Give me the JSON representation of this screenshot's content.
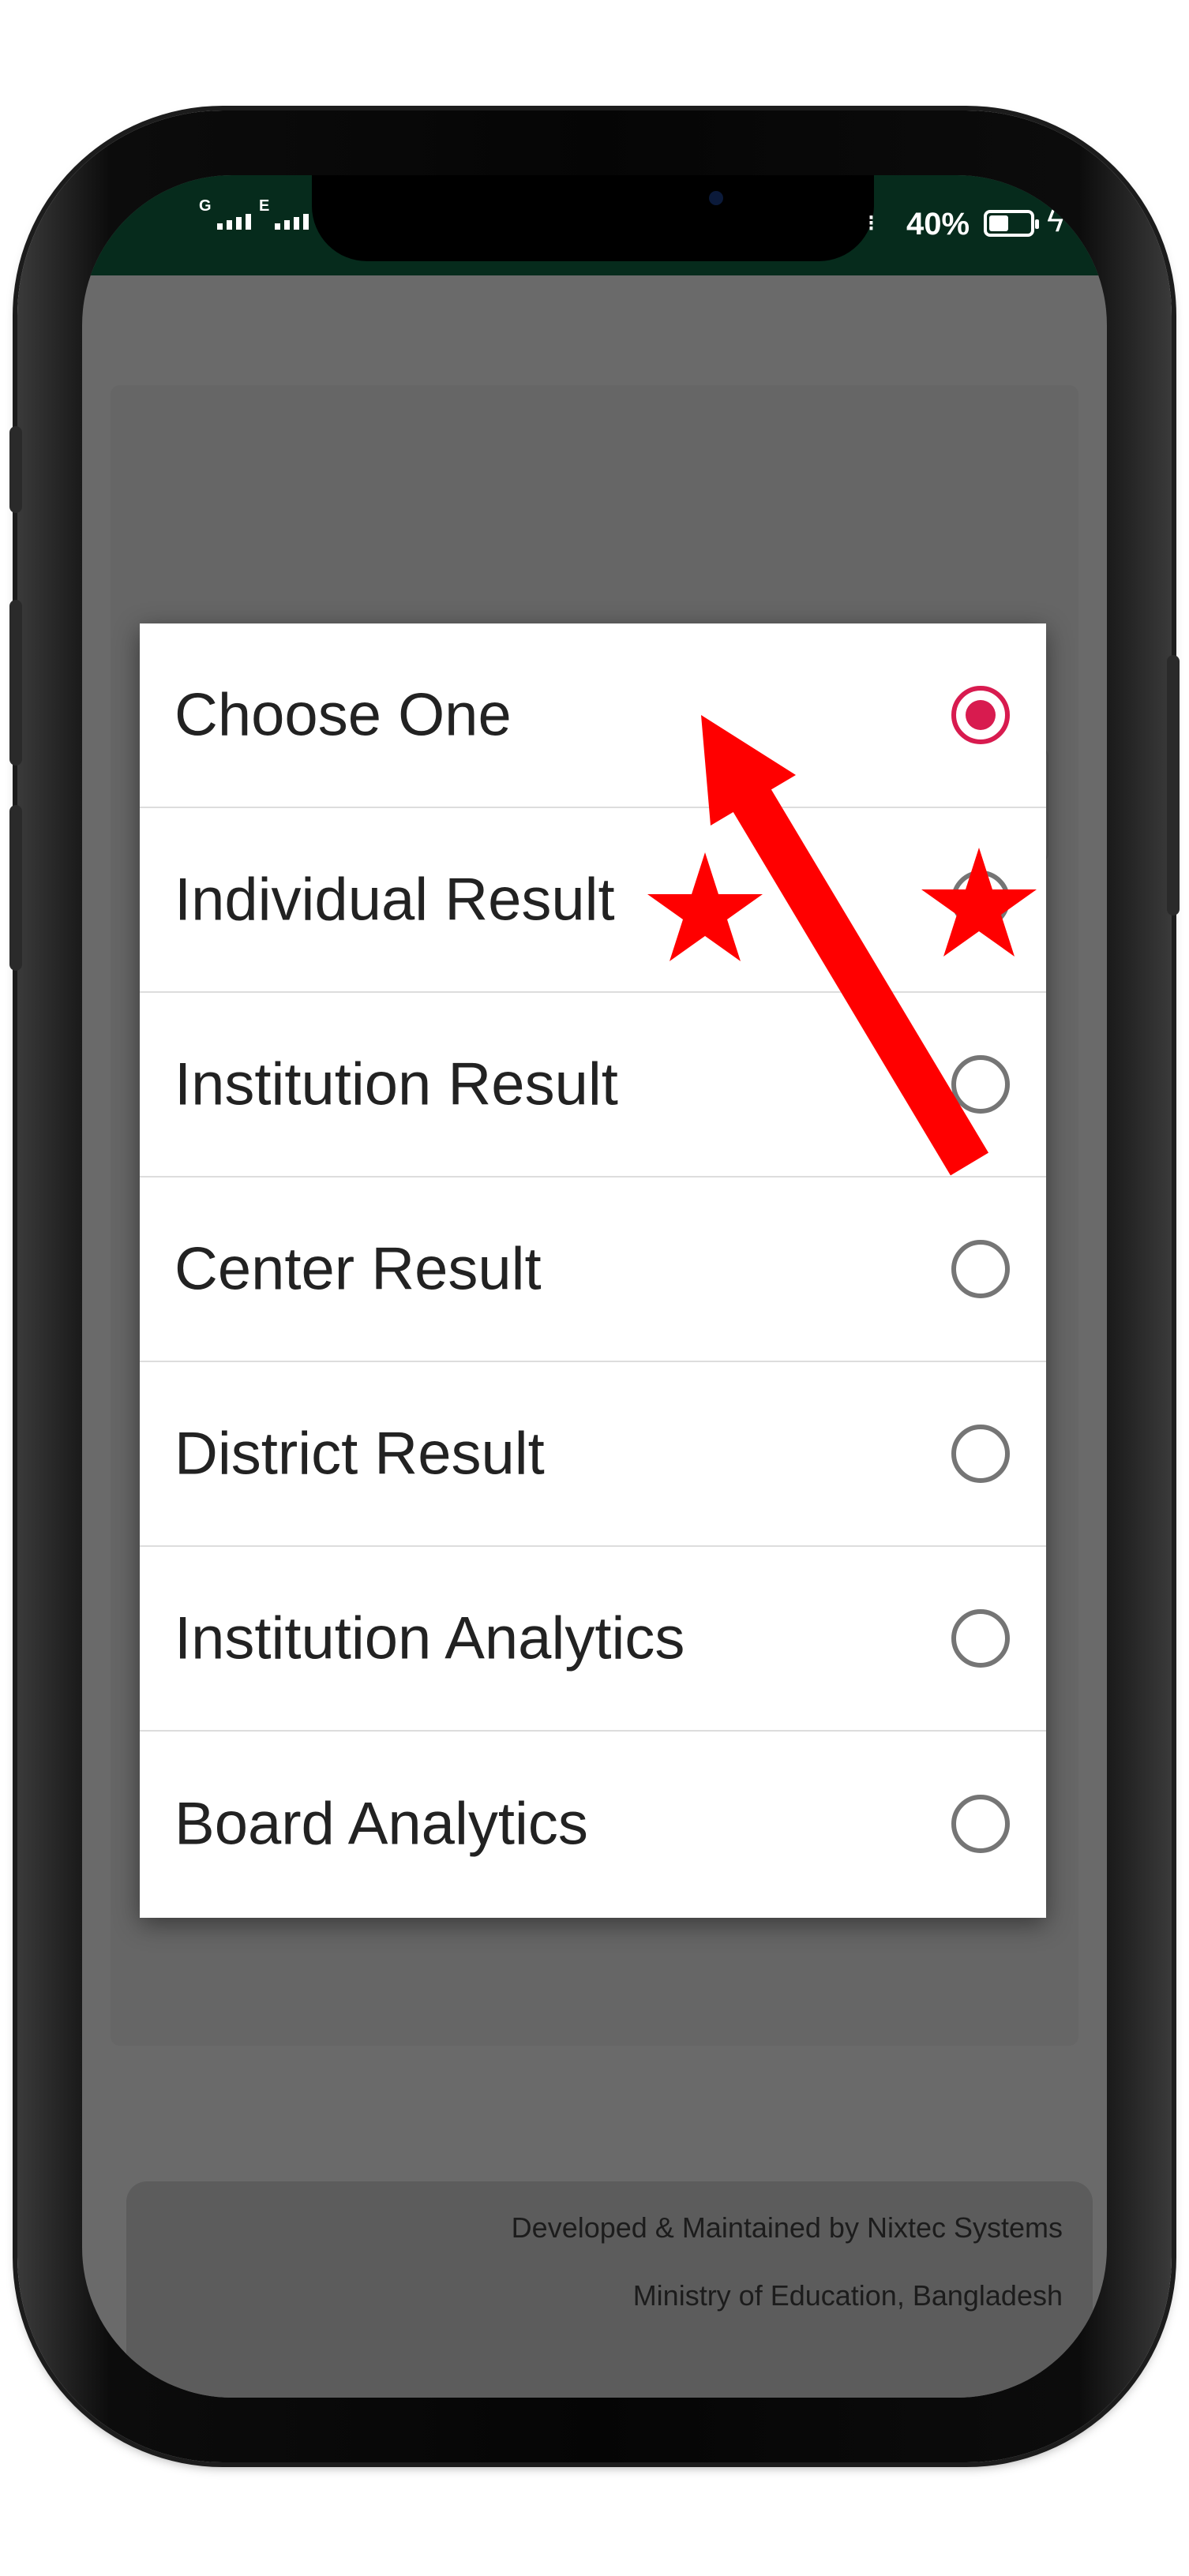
{
  "status_bar": {
    "signal_1_label": "G",
    "signal_2_label": "E",
    "battery_percent": "40%"
  },
  "dialog": {
    "options": [
      {
        "label": "Choose One",
        "selected": true
      },
      {
        "label": "Individual Result",
        "selected": false
      },
      {
        "label": "Institution Result",
        "selected": false
      },
      {
        "label": "Center Result",
        "selected": false
      },
      {
        "label": "District Result",
        "selected": false
      },
      {
        "label": "Institution Analytics",
        "selected": false
      },
      {
        "label": "Board Analytics",
        "selected": false
      }
    ]
  },
  "footer": {
    "line1": "Developed & Maintained by Nixtec Systems",
    "line2": "Ministry of Education, Bangladesh"
  },
  "nav_icons": [
    "menu-icon",
    "home-icon",
    "back-icon"
  ],
  "colors": {
    "radio_selected": "#d81b4f",
    "status_bar_bg": "#062b1c",
    "annotation_red": "#ff0000"
  }
}
